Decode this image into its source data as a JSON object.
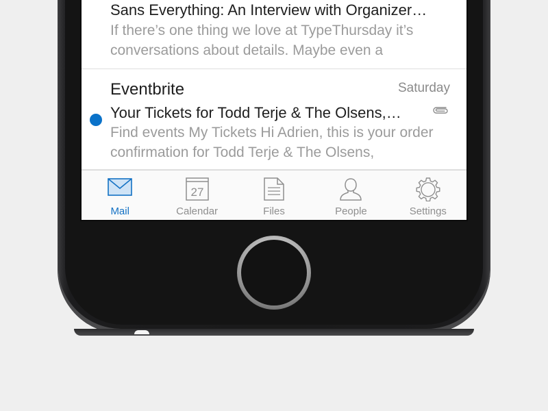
{
  "mail": {
    "items": [
      {
        "subject": "Sans Everything: An Interview with Organizer…",
        "preview": "If there’s one thing we love at TypeThursday it’s conversations about details. Maybe even a"
      },
      {
        "sender": "Eventbrite",
        "date": "Saturday",
        "subject": "Your Tickets for Todd Terje & The Olsens,…",
        "preview": "Find events My Tickets Hi Adrien, this is your order confirmation for Todd Terje & The Olsens,",
        "unread": true,
        "has_attachment": true
      }
    ]
  },
  "tabbar": {
    "tabs": [
      {
        "label": "Mail",
        "icon": "mail-icon",
        "active": true
      },
      {
        "label": "Calendar",
        "icon": "calendar-icon",
        "calendar_day": "27"
      },
      {
        "label": "Files",
        "icon": "file-icon"
      },
      {
        "label": "People",
        "icon": "person-icon"
      },
      {
        "label": "Settings",
        "icon": "gear-icon"
      }
    ]
  },
  "colors": {
    "accent": "#1371c4",
    "unread_dot": "#0a72c9",
    "background": "#efefef"
  }
}
